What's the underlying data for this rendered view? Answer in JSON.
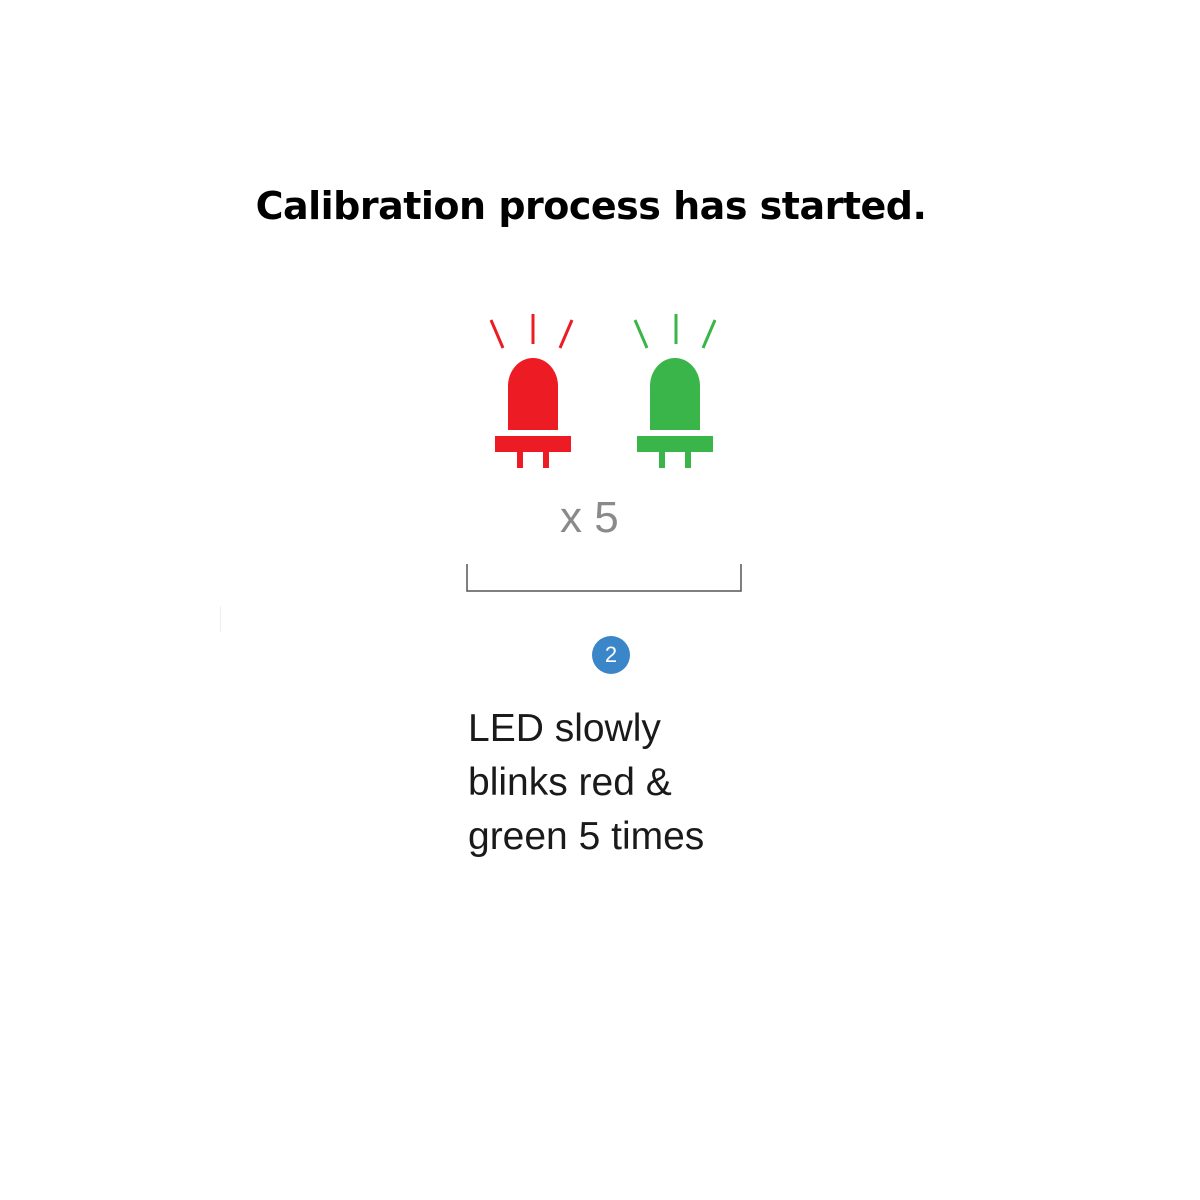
{
  "title": "Calibration process has started.",
  "indicator": {
    "leds": [
      {
        "name": "red-led",
        "color": "#ed1c24"
      },
      {
        "name": "green-led",
        "color": "#39b54a"
      }
    ],
    "repeat_label": "x 5"
  },
  "step": {
    "number": "2",
    "badge_color": "#3a86c8",
    "description_lines": [
      "LED slowly",
      "blinks red &",
      "green 5 times"
    ]
  }
}
